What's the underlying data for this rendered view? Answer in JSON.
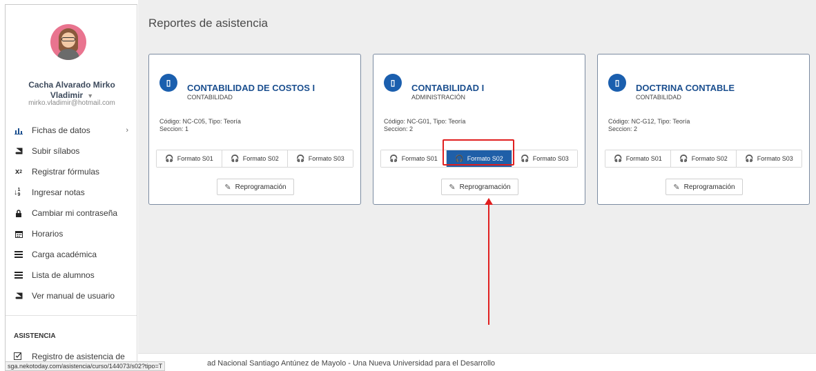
{
  "user": {
    "name": "Cacha Alvarado Mirko Vladimir",
    "email": "mirko.vladimir@hotmail.com"
  },
  "menu": [
    {
      "label": "Fichas de datos",
      "icon": "bar-chart-icon"
    },
    {
      "label": "Subir sílabos",
      "icon": "book-icon"
    },
    {
      "label": "Registrar fórmulas",
      "icon": "subscript-icon"
    },
    {
      "label": "Ingresar notas",
      "icon": "sort-numeric-icon"
    },
    {
      "label": "Cambiar mi contraseña",
      "icon": "lock-icon"
    },
    {
      "label": "Horarios",
      "icon": "calendar-icon"
    },
    {
      "label": "Carga académica",
      "icon": "list-icon"
    },
    {
      "label": "Lista de alumnos",
      "icon": "list-icon"
    },
    {
      "label": "Ver manual de usuario",
      "icon": "book-icon"
    }
  ],
  "section": {
    "title": "ASISTENCIA",
    "item": "Registro de asistencia de"
  },
  "page": {
    "title": "Reportes de asistencia"
  },
  "cards": [
    {
      "title": "CONTABILIDAD DE COSTOS I",
      "subtitle": "CONTABILIDAD",
      "info1": "Código: NC-C05, Tipo: Teoría",
      "info2": "Seccion: 1",
      "formats": [
        "Formato S01",
        "Formato S02",
        "Formato S03"
      ],
      "reprog": "Reprogramación"
    },
    {
      "title": "CONTABILIDAD I",
      "subtitle": "ADMINISTRACIÓN",
      "info1": "Código: NC-G01, Tipo: Teoría",
      "info2": "Seccion: 2",
      "formats": [
        "Formato S01",
        "Formato S02",
        "Formato S03"
      ],
      "reprog": "Reprogramación",
      "active_format": "Formato S02"
    },
    {
      "title": "DOCTRINA CONTABLE",
      "subtitle": "CONTABILIDAD",
      "info1": "Código: NC-G12, Tipo: Teoría",
      "info2": "Seccion: 2",
      "formats": [
        "Formato S01",
        "Formato S02",
        "Formato S03"
      ],
      "reprog": "Reprogramación"
    }
  ],
  "footer": {
    "text": "ad Nacional Santiago Antúnez de Mayolo - Una Nueva Universidad para el Desarrollo",
    "status_url": "sga.nekotoday.com/asistencia/curso/144073/s02?tipo=T"
  },
  "colors": {
    "accent": "#1f5fa8",
    "highlight": "#e01e1e"
  }
}
